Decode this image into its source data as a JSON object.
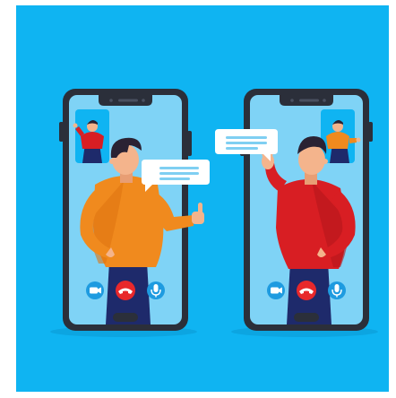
{
  "colors": {
    "background": "#0FB4F2",
    "phone_frame": "#2B2F3A",
    "screen": "#7FD3F6",
    "orange_shirt": "#F08A1E",
    "red_shirt": "#D81E23",
    "pants": "#1E2A6B",
    "skin": "#F4B48C",
    "hair": "#2A2233",
    "end_call": "#E8282B",
    "control_button": "#1E9BE0",
    "speech_bubble": "#FFFFFF",
    "speech_lines": "#7FCFF2"
  },
  "left_phone": {
    "caller": "man-orange-shirt",
    "pip": "man-red-shirt",
    "controls": [
      "camera-icon",
      "end-call-icon",
      "microphone-icon"
    ]
  },
  "right_phone": {
    "caller": "man-red-shirt",
    "pip": "man-orange-shirt",
    "controls": [
      "camera-icon",
      "end-call-icon",
      "microphone-icon"
    ]
  }
}
